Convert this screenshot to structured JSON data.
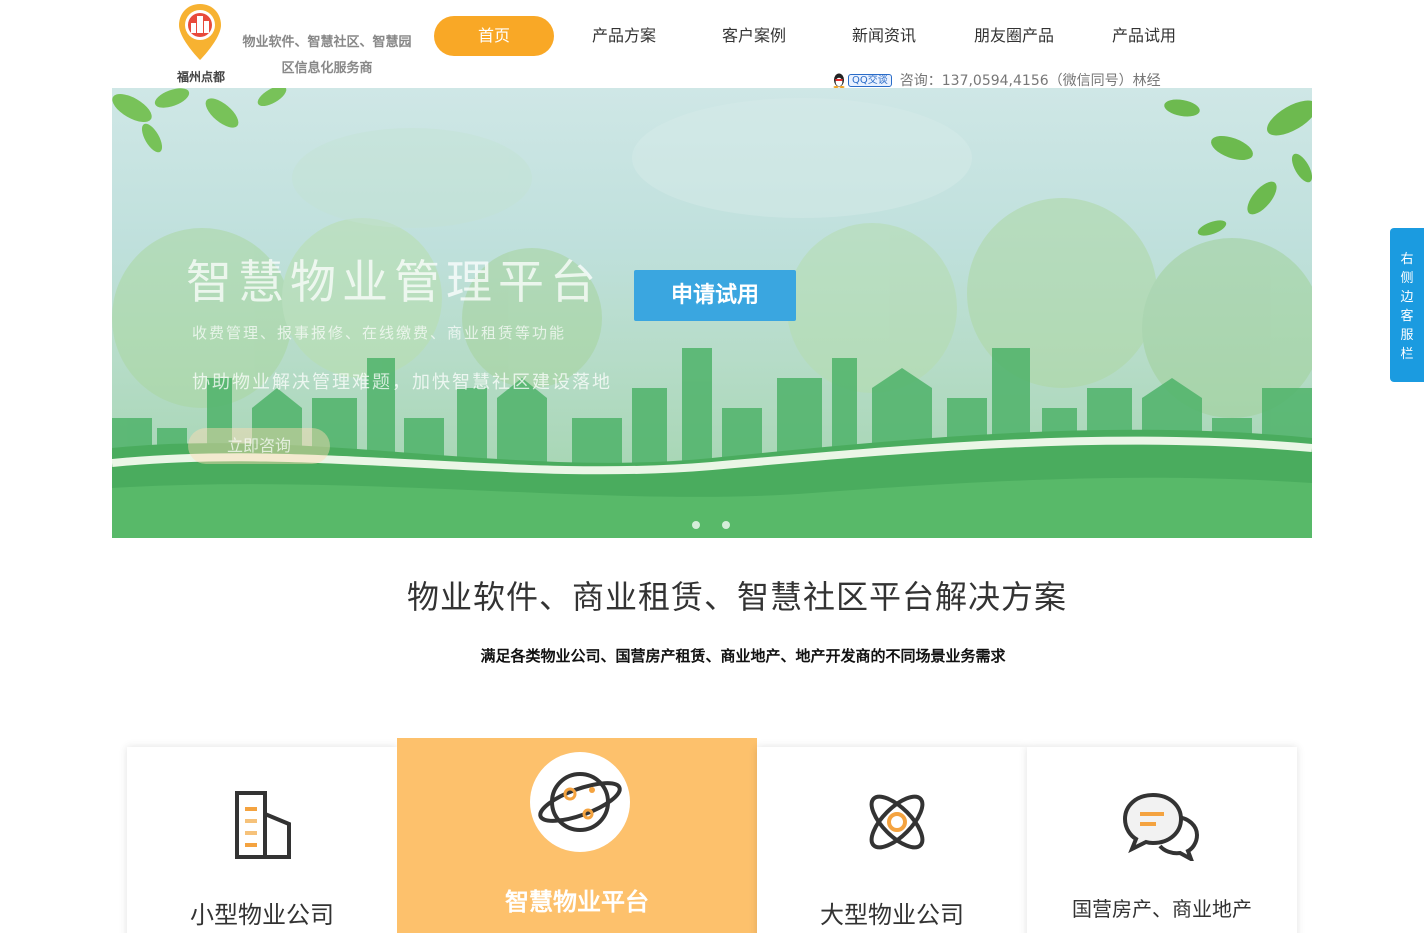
{
  "logo": {
    "name": "福州点都",
    "tagline": "物业软件、智慧社区、智慧园区信息化服务商"
  },
  "nav": {
    "items": [
      {
        "label": "首页",
        "active": true
      },
      {
        "label": "产品方案",
        "active": false
      },
      {
        "label": "客户案例",
        "active": false
      },
      {
        "label": "新闻资讯",
        "active": false
      },
      {
        "label": "朋友圈产品",
        "active": false
      },
      {
        "label": "产品试用",
        "active": false
      }
    ]
  },
  "contact": {
    "qq_label": "QQ交谈",
    "text": "咨询：137,0594,4156（微信同号）林经"
  },
  "banner": {
    "title": "智慧物业管理平台",
    "subtitle1": "收费管理、报事报修、在线缴费、商业租赁等功能",
    "subtitle2": "协助物业解决管理难题，加快智慧社区建设落地",
    "consult_label": "立即咨询",
    "trial_label": "申请试用",
    "slide_count": 2
  },
  "side_tab": {
    "label": "右侧边客服栏"
  },
  "section": {
    "title": "物业软件、商业租赁、智慧社区平台解决方案",
    "subtitle": "满足各类物业公司、国营房产租赁、商业地产、地产开发商的不同场景业务需求"
  },
  "cards": [
    {
      "label": "小型物业公司",
      "icon": "building-icon",
      "active": false
    },
    {
      "label": "智慧物业平台",
      "icon": "planet-icon",
      "active": true
    },
    {
      "label": "大型物业公司",
      "icon": "atom-icon",
      "active": false
    },
    {
      "label": "国营房产、商业地产",
      "icon": "chat-bubbles-icon",
      "active": false
    }
  ],
  "colors": {
    "accent": "#f9a826",
    "card_active": "#fdc16c",
    "trial_button": "#3aa6e0",
    "side_tab": "#1b9be0"
  }
}
